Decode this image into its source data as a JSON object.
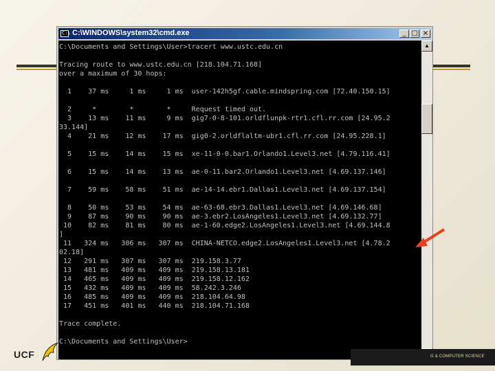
{
  "window": {
    "title": "C:\\WINDOWS\\system32\\cmd.exe",
    "icon_label": "C:\\",
    "minimize": "_",
    "maximize": "□",
    "close": "×"
  },
  "console_lines": [
    "C:\\Documents and Settings\\User>tracert www.ustc.edu.cn",
    "",
    "Tracing route to www.ustc.edu.cn [218.104.71.168]",
    "over a maximum of 30 hops:",
    "",
    "  1    37 ms     1 ms     1 ms  user-142h5gf.cable.mindspring.com [72.40.150.15]",
    "",
    "  2     *        *        *     Request timed out.",
    "  3    13 ms    11 ms     9 ms  gig7-0-8-101.orldflunpk-rtr1.cfl.rr.com [24.95.2",
    "33.144]",
    "  4    21 ms    12 ms    17 ms  gig0-2.orldflaltm-ubr1.cfl.rr.com [24.95.228.1]",
    "",
    "  5    15 ms    14 ms    15 ms  xe-11-0-0.bar1.Orlando1.Level3.net [4.79.116.41]",
    "",
    "  6    15 ms    14 ms    13 ms  ae-0-11.bar2.Orlando1.Level3.net [4.69.137.146]",
    "",
    "  7    59 ms    58 ms    51 ms  ae-14-14.ebr1.Dallas1.Level3.net [4.69.137.154]",
    "",
    "  8    50 ms    53 ms    54 ms  ae-63-68.ebr3.Dallas1.Level3.net [4.69.146.68]",
    "  9    87 ms    90 ms    90 ms  ae-3.ebr2.LosAngeles1.Level3.net [4.69.132.77]",
    " 10    82 ms    81 ms    80 ms  ae-1-60.edge2.LosAngeles1.Level3.net [4.69.144.8",
    "]",
    " 11   324 ms   306 ms   307 ms  CHINA-NETCO.edge2.LosAngeles1.Level3.net [4.78.2",
    "02.18]",
    " 12   291 ms   307 ms   307 ms  219.158.3.77",
    " 13   481 ms   409 ms   409 ms  219.158.13.181",
    " 14   465 ms   409 ms   409 ms  219.158.12.162",
    " 15   432 ms   409 ms   409 ms  58.242.3.246",
    " 16   485 ms   409 ms   409 ms  218.104.64.98",
    " 17   451 ms   401 ms   440 ms  218.104.71.168",
    "",
    "Trace complete.",
    "",
    "C:\\Documents and Settings\\User>"
  ],
  "scrollbar": {
    "up": "▲",
    "down": "▼"
  },
  "footer": {
    "logo_text": "UCF",
    "bar_text": "G & COMPUTER SCIENCE"
  },
  "colors": {
    "console_bg": "#000000",
    "console_text": "#c0c0c0",
    "arrow": "#e8401c",
    "title_gradient_start": "#0a246a"
  }
}
